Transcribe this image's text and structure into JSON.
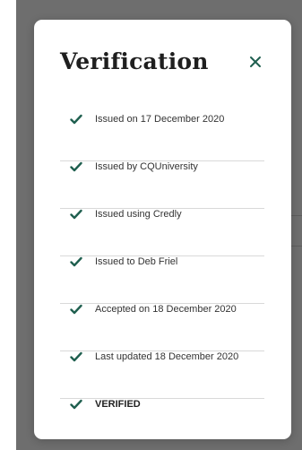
{
  "colors": {
    "accent": "#1f5f4f",
    "text": "#333333",
    "divider": "#d9d9d9",
    "overlay": "#333333"
  },
  "modal": {
    "title": "Verification",
    "close_icon": "close-icon",
    "items": [
      {
        "label": "Issued on 17 December 2020",
        "icon": "check-icon"
      },
      {
        "label": "Issued by CQUniversity",
        "icon": "check-icon"
      },
      {
        "label": "Issued using Credly",
        "icon": "check-icon"
      },
      {
        "label": "Issued to Deb Friel",
        "icon": "check-icon"
      },
      {
        "label": "Accepted on 18 December 2020",
        "icon": "check-icon"
      },
      {
        "label": "Last updated 18 December 2020",
        "icon": "check-icon"
      },
      {
        "label": "VERIFIED",
        "icon": "check-icon"
      }
    ]
  }
}
